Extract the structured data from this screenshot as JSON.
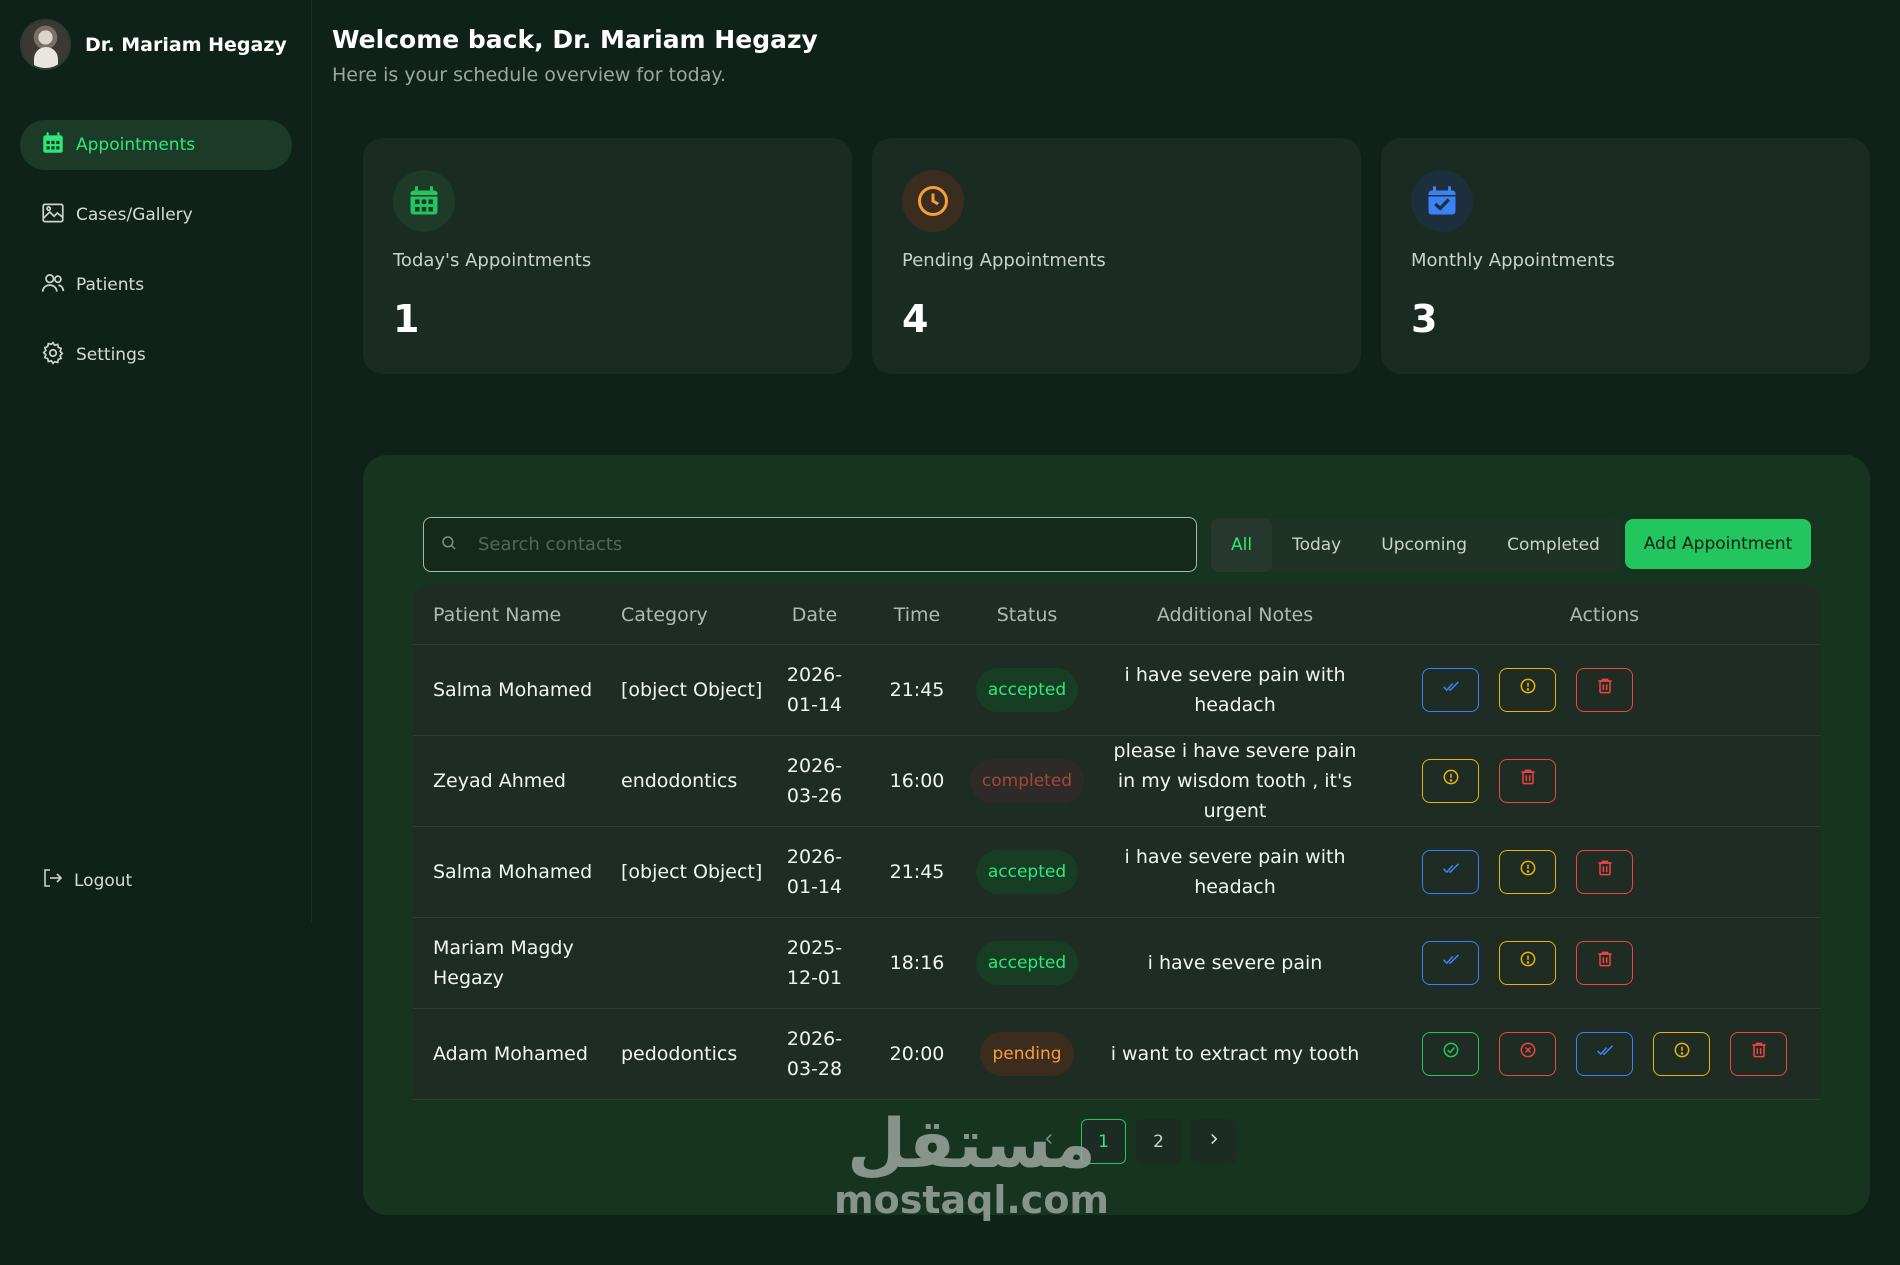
{
  "sidebar": {
    "profile_name": "Dr. Mariam Hegazy",
    "items": [
      {
        "label": "Appointments",
        "icon": "calendar-icon",
        "active": true
      },
      {
        "label": "Cases/Gallery",
        "icon": "gallery-icon",
        "active": false
      },
      {
        "label": "Patients",
        "icon": "users-icon",
        "active": false
      },
      {
        "label": "Settings",
        "icon": "gear-icon",
        "active": false
      }
    ],
    "logout_label": "Logout"
  },
  "header": {
    "title": "Welcome back, Dr. Mariam Hegazy",
    "subtitle": "Here is your schedule overview for today."
  },
  "stats": [
    {
      "label": "Today's Appointments",
      "value": "1",
      "icon": "calendar-icon",
      "color": "#22c55e"
    },
    {
      "label": "Pending Appointments",
      "value": "4",
      "icon": "clock-icon",
      "color": "#f59e3b"
    },
    {
      "label": "Monthly Appointments",
      "value": "3",
      "icon": "calendar-check-icon",
      "color": "#3b82f6"
    }
  ],
  "search": {
    "placeholder": "Search contacts",
    "value": ""
  },
  "filters": [
    {
      "label": "All",
      "active": true
    },
    {
      "label": "Today",
      "active": false
    },
    {
      "label": "Upcoming",
      "active": false
    },
    {
      "label": "Completed",
      "active": false
    }
  ],
  "add_button_label": "Add Appointment",
  "table": {
    "columns": [
      "Patient Name",
      "Category",
      "Date",
      "Time",
      "Status",
      "Additional Notes",
      "Actions"
    ],
    "rows": [
      {
        "name": "Salma Mohamed",
        "category": "[object Object]",
        "date": "2026-01-14",
        "time": "21:45",
        "status": "accepted",
        "notes": "i have severe pain with headach",
        "actions": [
          "mark-done",
          "info",
          "delete"
        ]
      },
      {
        "name": "Zeyad Ahmed",
        "category": "endodontics",
        "date": "2026-03-26",
        "time": "16:00",
        "status": "completed",
        "notes": "please i have severe pain in my wisdom tooth , it's urgent",
        "actions": [
          "info",
          "delete"
        ]
      },
      {
        "name": "Salma Mohamed",
        "category": "[object Object]",
        "date": "2026-01-14",
        "time": "21:45",
        "status": "accepted",
        "notes": "i have severe pain with headach",
        "actions": [
          "mark-done",
          "info",
          "delete"
        ]
      },
      {
        "name": "Mariam Magdy Hegazy",
        "category": "",
        "date": "2025-12-01",
        "time": "18:16",
        "status": "accepted",
        "notes": "i have severe pain",
        "actions": [
          "mark-done",
          "info",
          "delete"
        ]
      },
      {
        "name": "Adam Mohamed",
        "category": "pedodontics",
        "date": "2026-03-28",
        "time": "20:00",
        "status": "pending",
        "notes": "i want to extract my tooth",
        "actions": [
          "accept",
          "reject",
          "mark-done",
          "info",
          "delete"
        ]
      }
    ]
  },
  "pagination": {
    "pages": [
      "1",
      "2"
    ],
    "current": "1"
  },
  "watermark": {
    "arabic": "مستقل",
    "latin": "mostaql.com"
  }
}
